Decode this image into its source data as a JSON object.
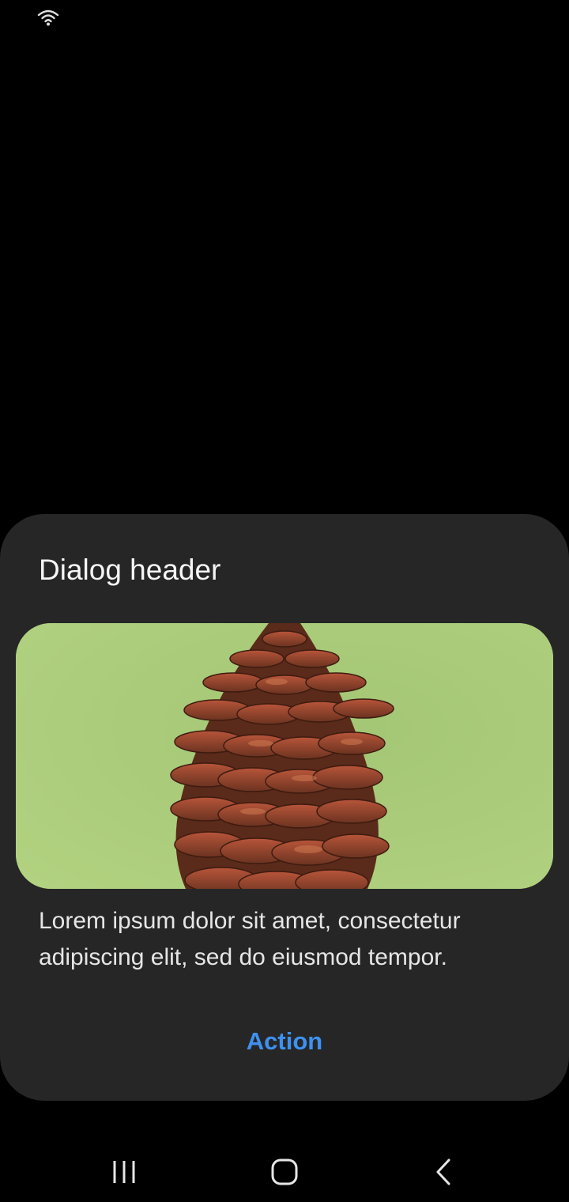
{
  "status_bar": {
    "icons": [
      "wifi-icon"
    ]
  },
  "dialog": {
    "title": "Dialog header",
    "image": {
      "subject": "pine-cone-image"
    },
    "body": "Lorem ipsum dolor sit amet, consectetur adipiscing elit, sed do eiusmod tempor.",
    "action_label": "Action"
  },
  "navigation_bar": {
    "buttons": [
      "recent-apps-icon",
      "home-icon",
      "back-icon"
    ]
  },
  "colors": {
    "background": "#000000",
    "dialog_background": "#262626",
    "title_text": "#f5f5f5",
    "body_text": "#e6e6e6",
    "accent": "#3e91f0",
    "image_background": "#a8ca7a"
  }
}
